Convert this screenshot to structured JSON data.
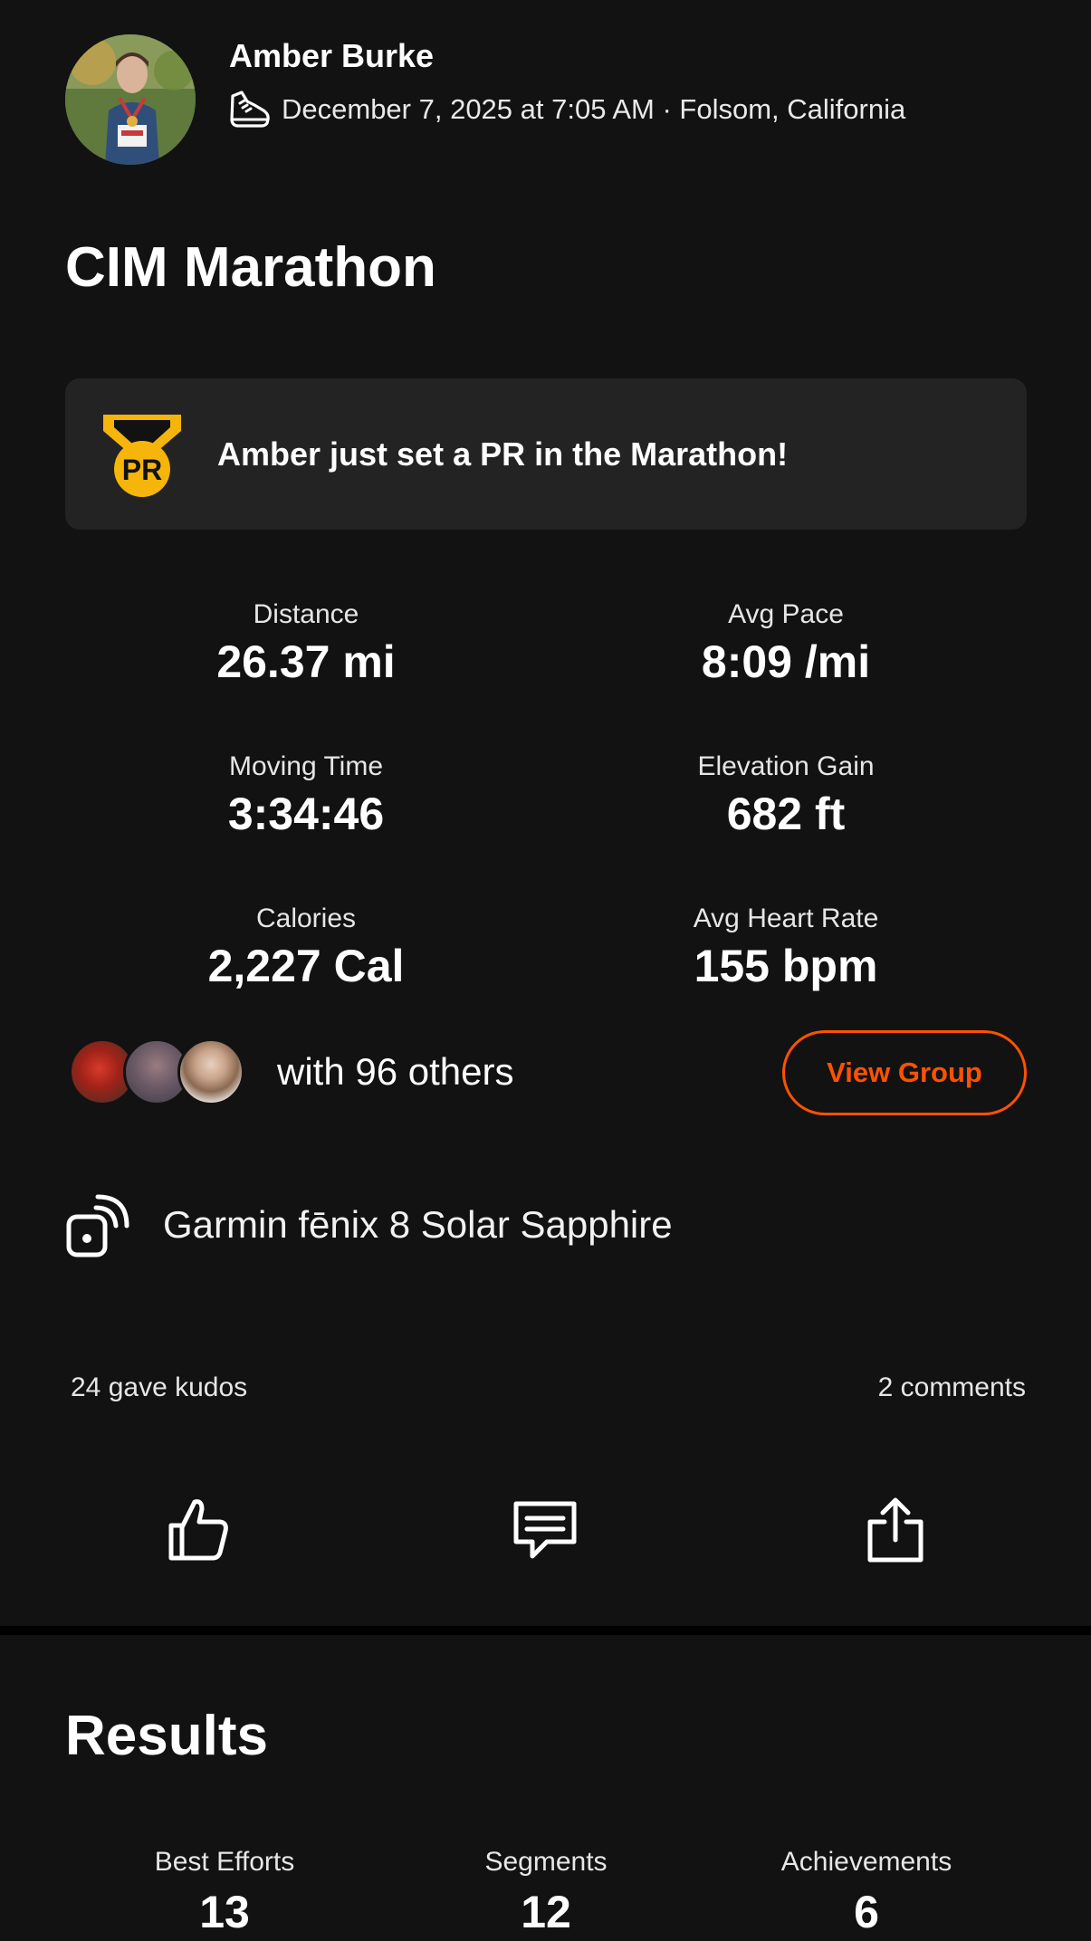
{
  "header": {
    "athlete_name": "Amber Burke",
    "activity_icon": "running-shoe-icon",
    "meta": "December 7, 2025 at 7:05 AM · Folsom, California"
  },
  "activity": {
    "title": "CIM Marathon"
  },
  "pr_banner": {
    "icon": "pr-medal-icon",
    "medal_text": "PR",
    "text": "Amber just set a PR in the Marathon!",
    "color": "#f5b50a"
  },
  "stats": [
    {
      "label": "Distance",
      "value": "26.37 mi"
    },
    {
      "label": "Avg Pace",
      "value": "8:09 /mi"
    },
    {
      "label": "Moving Time",
      "value": "3:34:46"
    },
    {
      "label": "Elevation Gain",
      "value": "682 ft"
    },
    {
      "label": "Calories",
      "value": "2,227 Cal"
    },
    {
      "label": "Avg Heart Rate",
      "value": "155 bpm"
    }
  ],
  "group": {
    "text": "with 96 others",
    "button_label": "View Group",
    "accent_color": "#fc5200"
  },
  "device": {
    "icon": "device-connected-icon",
    "name": "Garmin fēnix 8 Solar Sapphire"
  },
  "social": {
    "kudos_text": "24 gave kudos",
    "comments_text": "2 comments"
  },
  "actions": [
    {
      "icon": "thumbs-up-icon"
    },
    {
      "icon": "comment-icon"
    },
    {
      "icon": "share-icon"
    }
  ],
  "results": {
    "title": "Results",
    "columns": [
      {
        "label": "Best Efforts",
        "value": "13"
      },
      {
        "label": "Segments",
        "value": "12"
      },
      {
        "label": "Achievements",
        "value": "6"
      }
    ]
  }
}
